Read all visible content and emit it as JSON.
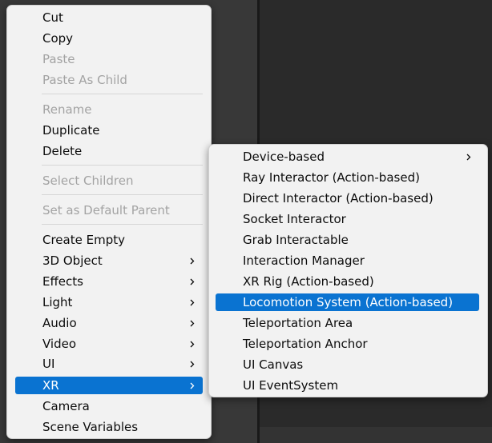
{
  "context_menu": {
    "items": [
      {
        "label": "Cut",
        "enabled": true
      },
      {
        "label": "Copy",
        "enabled": true
      },
      {
        "label": "Paste",
        "enabled": false
      },
      {
        "label": "Paste As Child",
        "enabled": false
      },
      {
        "label": "Rename",
        "enabled": false
      },
      {
        "label": "Duplicate",
        "enabled": true
      },
      {
        "label": "Delete",
        "enabled": true
      },
      {
        "label": "Select Children",
        "enabled": false
      },
      {
        "label": "Set as Default Parent",
        "enabled": false
      },
      {
        "label": "Create Empty",
        "enabled": true
      },
      {
        "label": "3D Object",
        "enabled": true,
        "submenu": true
      },
      {
        "label": "Effects",
        "enabled": true,
        "submenu": true
      },
      {
        "label": "Light",
        "enabled": true,
        "submenu": true
      },
      {
        "label": "Audio",
        "enabled": true,
        "submenu": true
      },
      {
        "label": "Video",
        "enabled": true,
        "submenu": true
      },
      {
        "label": "UI",
        "enabled": true,
        "submenu": true
      },
      {
        "label": "XR",
        "enabled": true,
        "submenu": true,
        "selected": true
      },
      {
        "label": "Camera",
        "enabled": true
      },
      {
        "label": "Scene Variables",
        "enabled": true
      }
    ]
  },
  "xr_submenu": {
    "items": [
      {
        "label": "Device-based",
        "submenu": true
      },
      {
        "label": "Ray Interactor (Action-based)"
      },
      {
        "label": "Direct Interactor (Action-based)"
      },
      {
        "label": "Socket Interactor"
      },
      {
        "label": "Grab Interactable"
      },
      {
        "label": "Interaction Manager"
      },
      {
        "label": "XR Rig (Action-based)"
      },
      {
        "label": "Locomotion System (Action-based)",
        "selected": true
      },
      {
        "label": "Teleportation Area"
      },
      {
        "label": "Teleportation Anchor"
      },
      {
        "label": "UI Canvas"
      },
      {
        "label": "UI EventSystem"
      }
    ]
  },
  "colors": {
    "menu_background": "#f2f2f2",
    "selection": "#0a73d1",
    "text": "#0c0c0c",
    "disabled_text": "#a3a3a3",
    "separator": "#d6d6d6"
  },
  "icons": {
    "submenu_arrow": "chevron-right-icon"
  }
}
